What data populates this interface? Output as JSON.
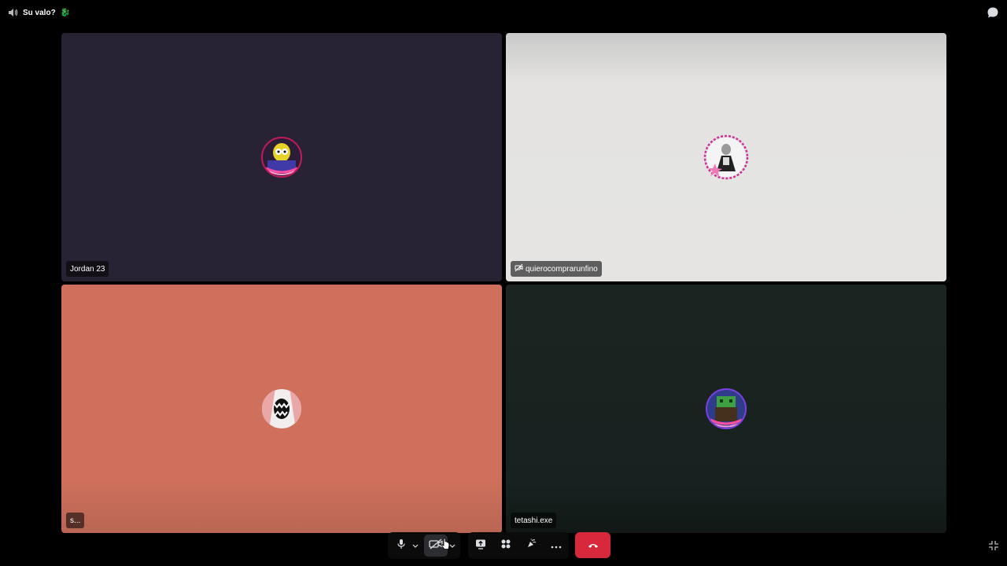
{
  "channel": {
    "name": "Su valo?",
    "emoji": "🐉"
  },
  "participants": [
    {
      "name": "Jordan 23",
      "muted_icon": false
    },
    {
      "name": "quierocomprarunfino",
      "muted_icon": true
    },
    {
      "name": "s...",
      "muted_icon": false
    },
    {
      "name": "tetashi.exe",
      "muted_icon": false
    }
  ],
  "colors": {
    "tile_1": "#282334",
    "tile_2": "#e5e4e2",
    "tile_3": "#cf705c",
    "tile_4": "#172220",
    "leave": "#d8283b"
  },
  "controls": [
    "microphone-icon",
    "mic-options-chevron-icon",
    "camera-off-icon",
    "camera-options-chevron-icon",
    "screen-share-icon",
    "activities-icon",
    "soundboard-icon",
    "more-options-icon",
    "leave-call-icon"
  ]
}
